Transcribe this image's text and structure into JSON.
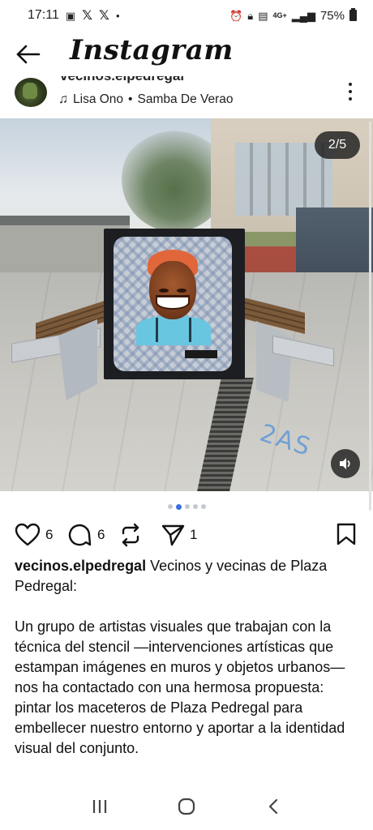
{
  "status_bar": {
    "time": "17:11",
    "signal_label": "4G+",
    "battery": "75%"
  },
  "header": {
    "title": "Instagram"
  },
  "post": {
    "username": "vecinos.elpedregal",
    "username_partial": "vecinos.elpedregal",
    "music_artist": "Lisa Ono",
    "music_separator": "•",
    "music_track": "Samba De Verao",
    "image_counter": "2/5",
    "carousel_total": 5,
    "carousel_current": 2,
    "graffiti_text": "2AS"
  },
  "actions": {
    "likes": "6",
    "comments": "6",
    "shares": "1"
  },
  "caption": {
    "username": "vecinos.elpedregal",
    "line1": "Vecinos y vecinas de Plaza Pedregal:",
    "paragraph": "Un grupo de artistas visuales que trabajan con la técnica del stencil —intervenciones artísticas que estampan imágenes en muros y objetos urbanos— nos ha contactado con una hermosa propuesta: pintar los maceteros de Plaza Pedregal para embellecer nuestro entorno y aportar a la identidad visual del conjunto."
  },
  "icons": {
    "back": "arrow-left-icon",
    "more": "more-vertical-icon",
    "music": "music-note-icon",
    "like": "heart-icon",
    "comment": "comment-icon",
    "repost": "repost-icon",
    "share": "send-icon",
    "save": "bookmark-icon",
    "sound": "speaker-icon"
  },
  "colors": {
    "accent": "#3b6fe0",
    "text": "#111111",
    "background": "#ffffff"
  }
}
